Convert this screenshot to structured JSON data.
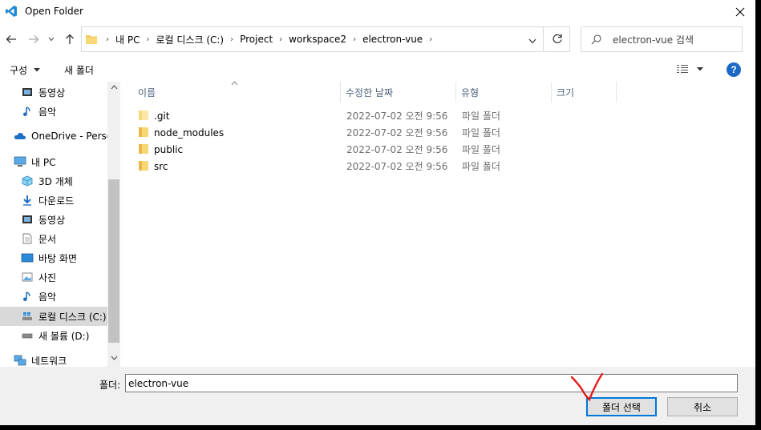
{
  "window": {
    "title": "Open Folder"
  },
  "address": {
    "crumbs": [
      "내 PC",
      "로컬 디스크 (C:)",
      "Project",
      "workspace2",
      "electron-vue"
    ],
    "search_placeholder": "electron-vue 검색"
  },
  "toolbar": {
    "organize": "구성",
    "new_folder": "새 폴더"
  },
  "sidebar": {
    "items": [
      {
        "label": "동영상",
        "icon": "video-icon"
      },
      {
        "label": "음악",
        "icon": "music-icon"
      },
      {
        "label": "OneDrive - Personal",
        "icon": "cloud-icon"
      },
      {
        "label": "내 PC",
        "icon": "pc-icon"
      },
      {
        "label": "3D 개체",
        "icon": "cube-icon"
      },
      {
        "label": "다운로드",
        "icon": "download-icon"
      },
      {
        "label": "동영상",
        "icon": "video-icon"
      },
      {
        "label": "문서",
        "icon": "document-icon"
      },
      {
        "label": "바탕 화면",
        "icon": "desktop-icon"
      },
      {
        "label": "사진",
        "icon": "picture-icon"
      },
      {
        "label": "음악",
        "icon": "music-icon"
      },
      {
        "label": "로컬 디스크 (C:)",
        "icon": "drive-icon"
      },
      {
        "label": "새 볼륨 (D:)",
        "icon": "drive-icon"
      },
      {
        "label": "네트워크",
        "icon": "network-icon"
      }
    ]
  },
  "files": {
    "columns": [
      "이름",
      "수정한 날짜",
      "유형",
      "크기"
    ],
    "rows": [
      {
        "name": ".git",
        "date": "2022-07-02 오전 9:56",
        "type": "파일 폴더"
      },
      {
        "name": "node_modules",
        "date": "2022-07-02 오전 9:56",
        "type": "파일 폴더"
      },
      {
        "name": "public",
        "date": "2022-07-02 오전 9:56",
        "type": "파일 폴더"
      },
      {
        "name": "src",
        "date": "2022-07-02 오전 9:56",
        "type": "파일 폴더"
      }
    ]
  },
  "footer": {
    "folder_label": "폴더:",
    "folder_value": "electron-vue",
    "select_button": "폴더 선택",
    "cancel_button": "취소"
  },
  "colors": {
    "accent": "#0078d7",
    "folder": "#f3c85a",
    "annotation": "#e31b1b"
  }
}
